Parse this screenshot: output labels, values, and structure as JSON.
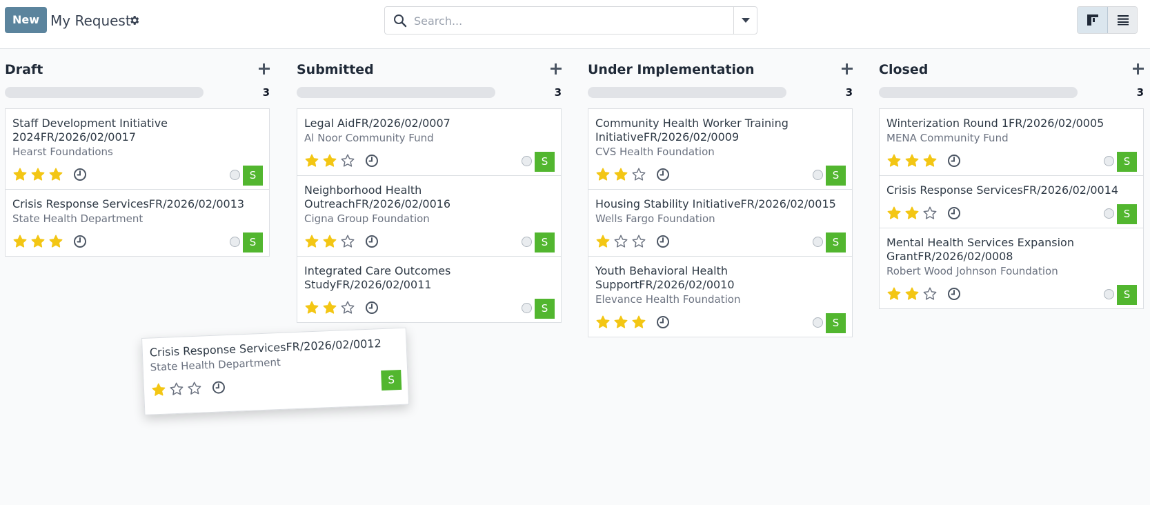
{
  "toolbar": {
    "new_label": "New",
    "title": "My Request",
    "search_placeholder": "Search..."
  },
  "colors": {
    "new_button": "#5b849d",
    "avatar": "#52b62f",
    "star_filled": "#f3c614",
    "star_empty": "#6b7280"
  },
  "icons": [
    "gear-icon",
    "search-icon",
    "chevron-down-icon",
    "kanban-view-icon",
    "list-view-icon",
    "plus-icon",
    "star-icon",
    "clock-icon"
  ],
  "columns": [
    {
      "title": "Draft",
      "count": "3",
      "cards": [
        {
          "title": "Staff Development Initiative 2024FR/2026/02/0017",
          "partner": "Hearst Foundations",
          "rating": 3,
          "avatar": "S"
        },
        {
          "title": "Crisis Response ServicesFR/2026/02/0013",
          "partner": "State Health Department",
          "rating": 3,
          "avatar": "S"
        }
      ]
    },
    {
      "title": "Submitted",
      "count": "3",
      "cards": [
        {
          "title": "Legal AidFR/2026/02/0007",
          "partner": "Al Noor Community Fund",
          "rating": 2,
          "avatar": "S"
        },
        {
          "title": "Neighborhood Health OutreachFR/2026/02/0016",
          "partner": "Cigna Group Foundation",
          "rating": 2,
          "avatar": "S"
        },
        {
          "title": "Integrated Care Outcomes StudyFR/2026/02/0011",
          "partner": "",
          "rating": 2,
          "avatar": "S"
        }
      ]
    },
    {
      "title": "Under Implementation",
      "count": "3",
      "cards": [
        {
          "title": "Community Health Worker Training InitiativeFR/2026/02/0009",
          "partner": "CVS Health Foundation",
          "rating": 2,
          "avatar": "S"
        },
        {
          "title": "Housing Stability InitiativeFR/2026/02/0015",
          "partner": "Wells Fargo Foundation",
          "rating": 1,
          "avatar": "S"
        },
        {
          "title": "Youth Behavioral Health SupportFR/2026/02/0010",
          "partner": "Elevance Health Foundation",
          "rating": 3,
          "avatar": "S"
        }
      ]
    },
    {
      "title": "Closed",
      "count": "3",
      "cards": [
        {
          "title": "Winterization Round 1FR/2026/02/0005",
          "partner": "MENA Community Fund",
          "rating": 3,
          "avatar": "S"
        },
        {
          "title": "Crisis Response ServicesFR/2026/02/0014",
          "partner": "",
          "rating": 2,
          "avatar": "S"
        },
        {
          "title": "Mental Health Services Expansion GrantFR/2026/02/0008",
          "partner": "Robert Wood Johnson Foundation",
          "rating": 2,
          "avatar": "S"
        }
      ]
    }
  ],
  "dragged_card": {
    "title": "Crisis Response ServicesFR/2026/02/0012",
    "partner": "State Health Department",
    "rating": 1,
    "avatar": "S"
  }
}
